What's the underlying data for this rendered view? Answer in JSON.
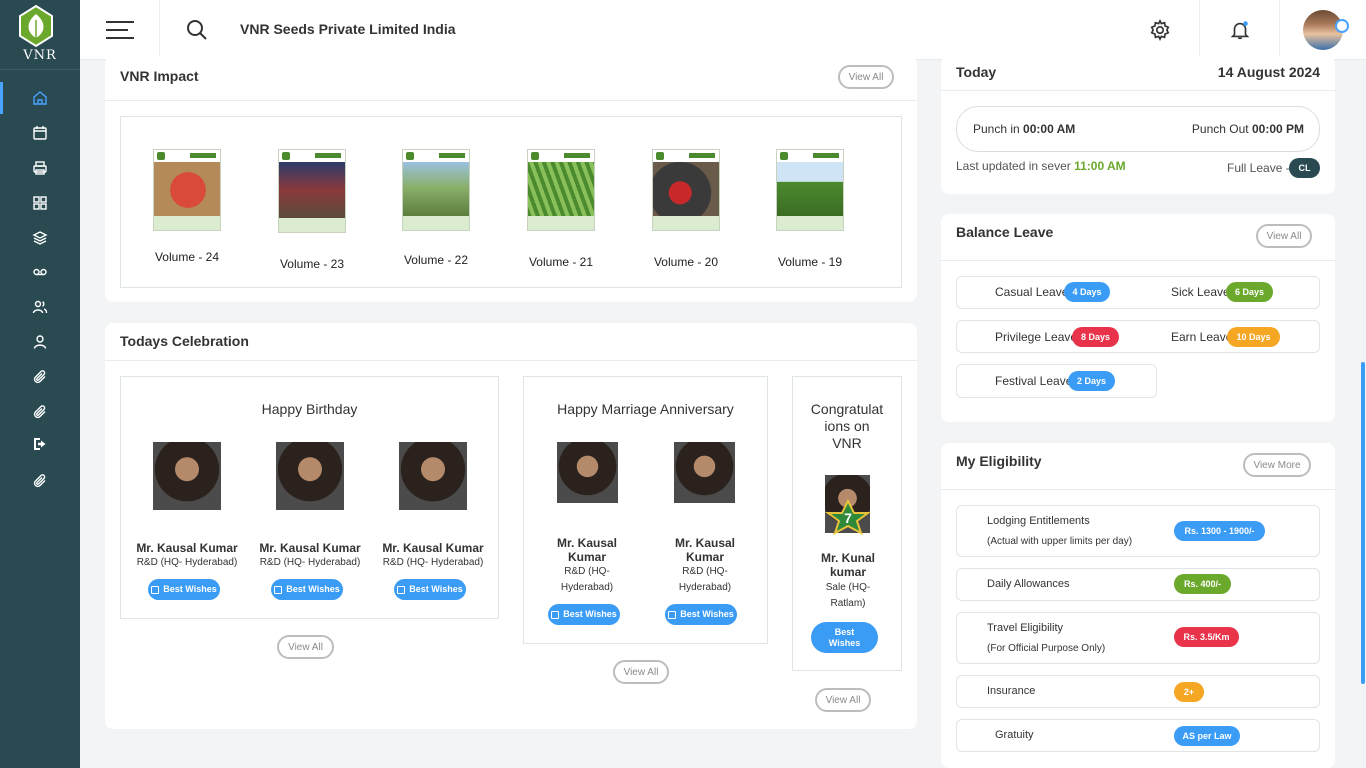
{
  "brand": {
    "logo_text": "VNR",
    "accent": "#4aa3ff",
    "sidebar_bg": "#2a4a52"
  },
  "header": {
    "company_name": "VNR Seeds Private Limited India",
    "icons": [
      "hamburger-icon",
      "search-icon",
      "gear-icon",
      "bell-icon",
      "avatar"
    ]
  },
  "sidebar": {
    "items": [
      {
        "icon": "home-icon",
        "active": true
      },
      {
        "icon": "calendar-icon"
      },
      {
        "icon": "printer-icon"
      },
      {
        "icon": "grid-icon"
      },
      {
        "icon": "layers-icon"
      },
      {
        "icon": "voicemail-icon"
      },
      {
        "icon": "users-icon"
      },
      {
        "icon": "user-icon"
      },
      {
        "icon": "paperclip-icon"
      },
      {
        "icon": "paperclip-icon"
      },
      {
        "icon": "logout-icon"
      },
      {
        "icon": "paperclip-icon"
      }
    ]
  },
  "impact": {
    "title": "VNR Impact",
    "view_all": "View All",
    "cover_header": "VNR Impact",
    "volumes": [
      "Volume - 24",
      "Volume - 23",
      "Volume - 22",
      "Volume - 21",
      "Volume - 20",
      "Volume - 19"
    ]
  },
  "celebration": {
    "title": "Todays Celebration",
    "birthday": {
      "title": "Happy Birthday",
      "people": [
        {
          "name": "Mr. Kausal Kumar",
          "dept": "R&D (HQ- Hyderabad)",
          "button": "Best Wishes"
        },
        {
          "name": "Mr. Kausal Kumar",
          "dept": "R&D (HQ- Hyderabad)",
          "button": "Best Wishes"
        },
        {
          "name": "Mr. Kausal Kumar",
          "dept": "R&D (HQ- Hyderabad)",
          "button": "Best Wishes"
        }
      ],
      "view_all": "View All"
    },
    "anniversary": {
      "title": "Happy Marriage Anniversary",
      "people": [
        {
          "name_1": "Mr. Kausal",
          "name_2": "Kumar",
          "dept_1": "R&D (HQ-",
          "dept_2": "Hyderabad)",
          "button": "Best Wishes"
        },
        {
          "name_1": "Mr. Kausal",
          "name_2": "Kumar",
          "dept_1": "R&D (HQ-",
          "dept_2": "Hyderabad)",
          "button": "Best Wishes"
        }
      ],
      "view_all": "View All"
    },
    "congrats": {
      "title_1": "Congratulat",
      "title_2": "ions on",
      "title_3": "VNR",
      "years": "7",
      "name_1": "Mr. Kunal",
      "name_2": "kumar",
      "dept_1": "Sale (HQ-",
      "dept_2": "Ratlam)",
      "button_1": "Best",
      "button_2": "Wishes",
      "view_all": "View All"
    }
  },
  "today": {
    "label": "Today",
    "date": "14 August 2024",
    "punch_in_label": "Punch in",
    "punch_in_time": "00:00 AM",
    "punch_out_label": "Punch Out",
    "punch_out_time": "00:00 PM",
    "last_updated_label": "Last updated in sever",
    "last_updated_time": "11:00 AM",
    "full_leave_label": "Full Leave -",
    "full_leave_code": "CL",
    "time_color": "#6aa92c"
  },
  "balance_leave": {
    "title": "Balance Leave",
    "view_all": "View All",
    "items": [
      {
        "label": "Casual Leave",
        "value": "4 Days",
        "color": "#3b9cf5"
      },
      {
        "label": "Sick Leave",
        "value": "6 Days",
        "color": "#6aa92c"
      },
      {
        "label": "Privilege Leave",
        "value": "8 Days",
        "color": "#e8334a"
      },
      {
        "label": "Earn Leave",
        "value": "10 Days",
        "color": "#f5a623"
      },
      {
        "label": "Festival Leave",
        "value": "2 Days",
        "color": "#3b9cf5"
      }
    ]
  },
  "eligibility": {
    "title": "My Eligibility",
    "view_more": "View More",
    "items": [
      {
        "label": "Lodging Entitlements",
        "sub": "(Actual with upper limits per day)",
        "value": "Rs. 1300 - 1900/-",
        "color": "#3b9cf5"
      },
      {
        "label": "Daily Allowances",
        "sub": "",
        "value": "Rs. 400/-",
        "color": "#6aa92c"
      },
      {
        "label": "Travel Eligibility",
        "sub": "(For Official Purpose Only)",
        "value": "Rs. 3.5/Km",
        "color": "#e8334a"
      },
      {
        "label": "Insurance",
        "sub": "",
        "value": "2+",
        "color": "#f5a623"
      },
      {
        "label": "Gratuity",
        "sub": "",
        "value": "AS per Law",
        "color": "#3b9cf5"
      }
    ]
  }
}
